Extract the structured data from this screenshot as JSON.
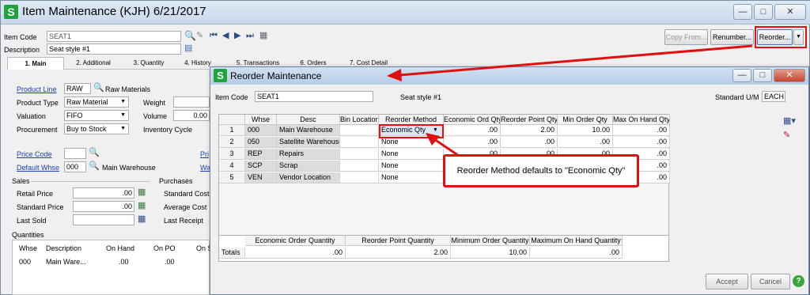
{
  "main_window": {
    "title": "Item Maintenance (KJH) 6/21/2017",
    "app_icon": "S",
    "item_code_label": "Item Code",
    "item_code_value": "SEAT1",
    "description_label": "Description",
    "description_value": "Seat style #1",
    "buttons": {
      "copy_from": "Copy From...",
      "renumber": "Renumber...",
      "reorder": "Reorder..."
    },
    "tabs": [
      "1. Main",
      "2. Additional",
      "3. Quantity",
      "4. History",
      "5. Transactions",
      "6. Orders",
      "7. Cost Detail"
    ],
    "product_line_label": "Product Line",
    "product_line_value": "RAW",
    "product_line_desc": "Raw Materials",
    "product_type_label": "Product Type",
    "product_type_value": "Raw Material",
    "valuation_label": "Valuation",
    "valuation_value": "FIFO",
    "procurement_label": "Procurement",
    "procurement_value": "Buy to Stock",
    "weight_label": "Weight",
    "volume_label": "Volume",
    "volume_value": "0.00",
    "inventory_cycle_label": "Inventory Cycle",
    "price_code_label": "Price Code",
    "default_whse_label": "Default Whse",
    "default_whse_value": "000",
    "default_whse_desc": "Main Warehouse",
    "pri_link": "Pri",
    "wa_link": "Wa",
    "sales_header": "Sales",
    "retail_price_label": "Retail Price",
    "retail_price_value": ".00",
    "standard_price_label": "Standard Price",
    "standard_price_value": ".00",
    "last_sold_label": "Last Sold",
    "purchases_header": "Purchases",
    "standard_cost_label": "Standard Cost",
    "average_cost_label": "Average Cost",
    "last_receipt_label": "Last Receipt",
    "quantities_header": "Quantities",
    "qty_columns": [
      "Whse",
      "Description",
      "On Hand",
      "On PO",
      "On S"
    ],
    "qty_row": [
      "000",
      "Main Ware...",
      ".00",
      ".00",
      ".00"
    ]
  },
  "reorder_dialog": {
    "title": "Reorder Maintenance",
    "item_code_label": "Item Code",
    "item_code_value": "SEAT1",
    "item_desc": "Seat style #1",
    "standard_um_label": "Standard U/M",
    "standard_um_value": "EACH",
    "columns": [
      "Whse",
      "Desc",
      "Bin Location",
      "Reorder Method",
      "Economic Ord Qty",
      "Reorder Point Qty",
      "Min Order Qty",
      "Max On Hand Qty"
    ],
    "rows": [
      {
        "num": "1",
        "whse": "000",
        "desc": "Main Warehouse",
        "bin": "",
        "method": "Economic Qty",
        "eoq": ".00",
        "rpq": "2.00",
        "min": "10.00",
        "max": ".00"
      },
      {
        "num": "2",
        "whse": "050",
        "desc": "Satellite Warehouse",
        "bin": "",
        "method": "None",
        "eoq": ".00",
        "rpq": ".00",
        "min": ".00",
        "max": ".00"
      },
      {
        "num": "3",
        "whse": "REP",
        "desc": "Repairs",
        "bin": "",
        "method": "None",
        "eoq": ".00",
        "rpq": ".00",
        "min": ".00",
        "max": ".00"
      },
      {
        "num": "4",
        "whse": "SCP",
        "desc": "Scrap",
        "bin": "",
        "method": "None",
        "eoq": "",
        "rpq": "",
        "min": "",
        "max": ".00"
      },
      {
        "num": "5",
        "whse": "VEN",
        "desc": "Vendor Location",
        "bin": "",
        "method": "None",
        "eoq": "",
        "rpq": "",
        "min": "",
        "max": ".00"
      }
    ],
    "totals_columns": [
      "Economic Order Quantity",
      "Reorder Point Quantity",
      "Minimum Order Quantity",
      "Maximum On Hand Quantity"
    ],
    "totals_label": "Totals",
    "totals_values": [
      ".00",
      "2.00",
      "10.00",
      ".00"
    ],
    "accept_label": "Accept",
    "cancel_label": "Cancel"
  },
  "callout": {
    "text": "Reorder Method defaults to \"Economic Qty\""
  },
  "colors": {
    "annotation_red": "#e01010",
    "app_green": "#1fa33a",
    "link_blue": "#1a3fbf"
  }
}
